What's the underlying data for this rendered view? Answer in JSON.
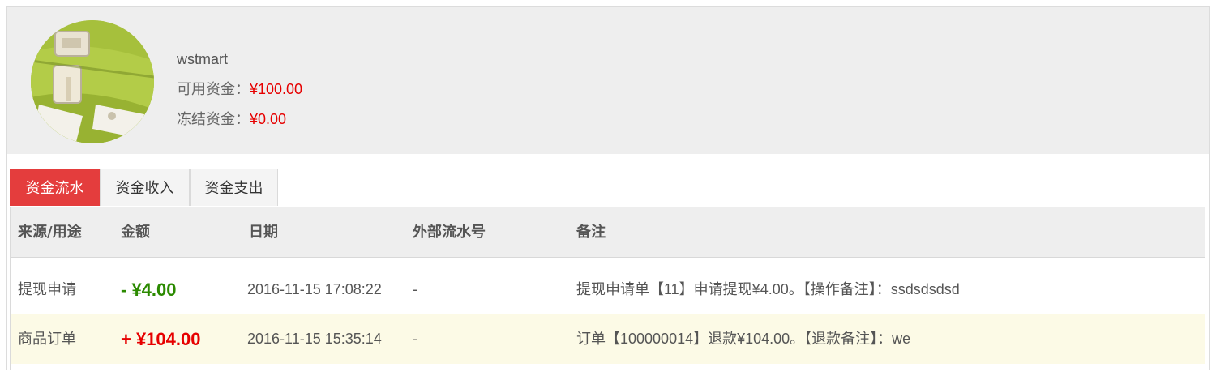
{
  "profile": {
    "username": "wstmart",
    "available_label": "可用资金：",
    "available_value": "¥100.00",
    "frozen_label": "冻结资金：",
    "frozen_value": "¥0.00"
  },
  "tabs": [
    {
      "label": "资金流水",
      "active": true
    },
    {
      "label": "资金收入",
      "active": false
    },
    {
      "label": "资金支出",
      "active": false
    }
  ],
  "table": {
    "headers": [
      "来源/用途",
      "金额",
      "日期",
      "外部流水号",
      "备注"
    ],
    "rows": [
      {
        "source": "提现申请",
        "amount": "- ¥4.00",
        "direction": "out",
        "date": "2016-11-15 17:08:22",
        "external_no": "-",
        "remark": "提现申请单【11】申请提现¥4.00。【操作备注】：ssdsdsdsd"
      },
      {
        "source": "商品订单",
        "amount": "+ ¥104.00",
        "direction": "in",
        "date": "2016-11-15 15:35:14",
        "external_no": "-",
        "remark": "订单【100000014】退款¥104.00。【退款备注】：we"
      }
    ]
  },
  "colors": {
    "accent_red": "#e43d3d",
    "money_red": "#e60000",
    "money_green": "#2b8a00",
    "highlight_row": "#fcfae6"
  }
}
